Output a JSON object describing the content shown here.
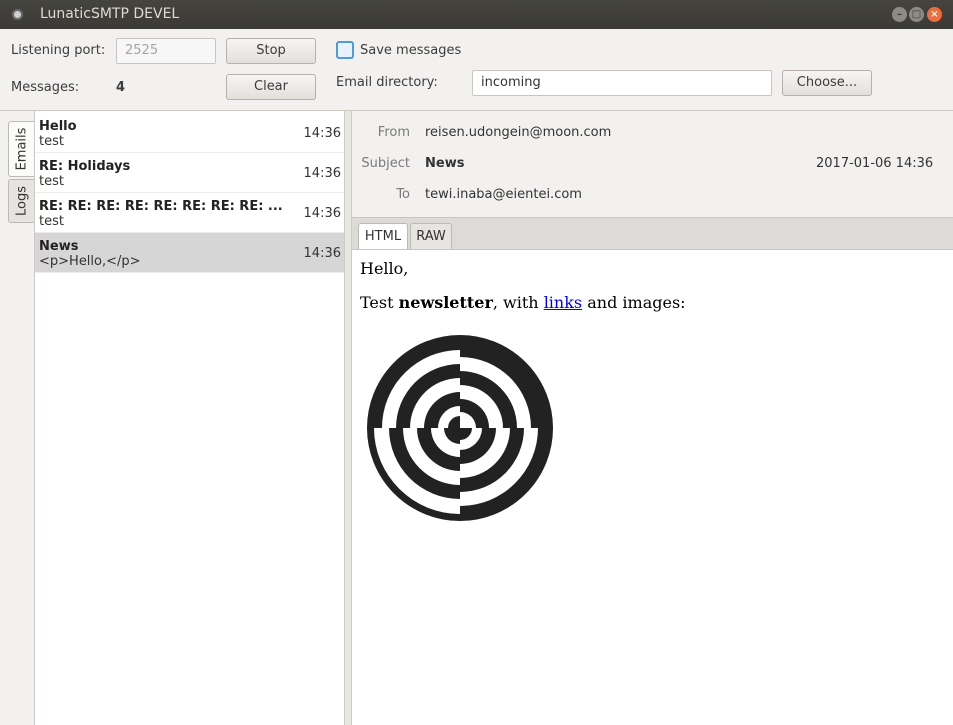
{
  "window": {
    "title": "LunaticSMTP DEVEL"
  },
  "toolbar": {
    "port_label": "Listening port:",
    "port_value": "2525",
    "stop_label": "Stop",
    "save_label": "Save messages",
    "messages_label": "Messages:",
    "messages_count": "4",
    "clear_label": "Clear",
    "dir_label": "Email directory:",
    "dir_value": "incoming",
    "choose_label": "Choose..."
  },
  "sidetabs": [
    "Emails",
    "Logs"
  ],
  "emails": [
    {
      "subject": "Hello",
      "preview": "test",
      "time": "14:36"
    },
    {
      "subject": "RE: Holidays",
      "preview": "test",
      "time": "14:36"
    },
    {
      "subject": "RE: RE: RE: RE: RE: RE: RE: RE: ...",
      "preview": "test",
      "time": "14:36"
    },
    {
      "subject": "News",
      "preview": "<p>Hello,</p>",
      "time": "14:36"
    }
  ],
  "detail": {
    "from_label": "From",
    "from": "reisen.udongein@moon.com",
    "subject_label": "Subject",
    "subject": "News",
    "date": "2017-01-06 14:36",
    "to_label": "To",
    "to": "tewi.inaba@eientei.com",
    "tabs": [
      "HTML",
      "RAW"
    ],
    "body": {
      "greeting": "Hello,",
      "text_before": "Test ",
      "bold": "newsletter",
      "text_mid": ", with ",
      "link": "links",
      "text_after": " and images:"
    }
  }
}
